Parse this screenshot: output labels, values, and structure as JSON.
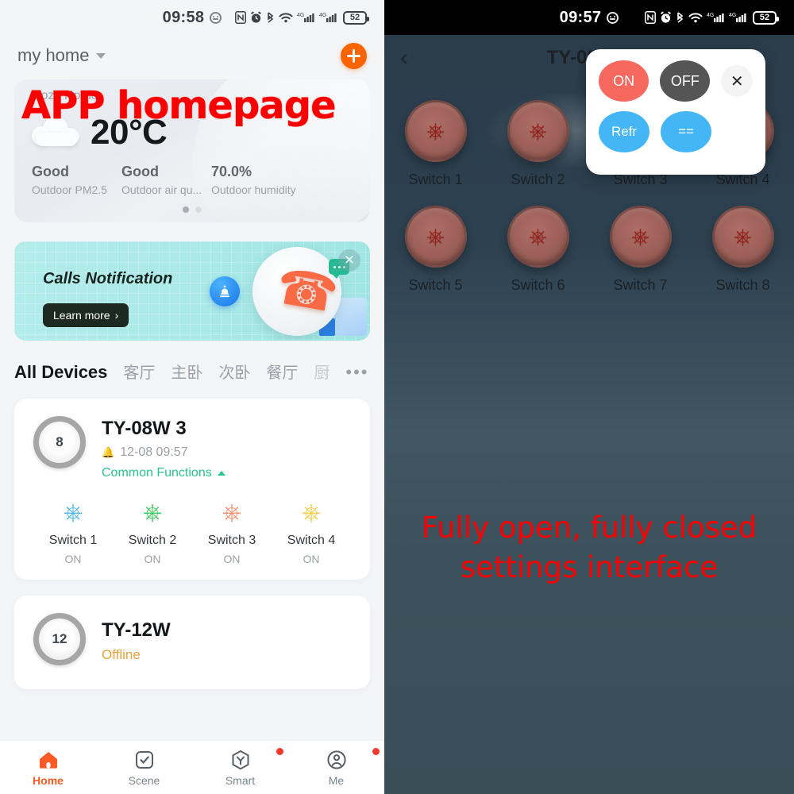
{
  "left": {
    "status_bar": {
      "time": "09:58",
      "icons": [
        "face-icon",
        "nfc-icon",
        "alarm-icon",
        "bluetooth-icon",
        "wifi-icon",
        "signal-4g-icon",
        "signal-4g-icon-2"
      ],
      "battery": "52"
    },
    "header": {
      "home_name": "my home",
      "chevron": "chevron-down-icon",
      "add": "add-icon"
    },
    "weather": {
      "subtitle": "Cozy Home",
      "temperature": "20°C",
      "icon": "cloud-icon",
      "stats": [
        {
          "value": "Good",
          "label": "Outdoor PM2.5"
        },
        {
          "value": "Good",
          "label": "Outdoor air qu..."
        },
        {
          "value": "70.0%",
          "label": "Outdoor humidity"
        }
      ],
      "pages": 2,
      "active_page": 1
    },
    "promo": {
      "title": "Calls Notification",
      "cta": "Learn more",
      "cta_chevron": "›",
      "close": "close-icon",
      "bell": "alarm-bell-icon",
      "phone": "phone-handset-icon",
      "chat": "chat-bubble-icon"
    },
    "rooms": [
      {
        "label": "All Devices",
        "active": true
      },
      {
        "label": "客厅",
        "active": false
      },
      {
        "label": "主卧",
        "active": false
      },
      {
        "label": "次卧",
        "active": false
      },
      {
        "label": "餐厅",
        "active": false
      },
      {
        "label": "厨",
        "active": false,
        "faded": true
      }
    ],
    "rooms_more": "•••",
    "devices": [
      {
        "badge": "8",
        "title": "TY-08W 3",
        "timestamp": "12-08 09:57",
        "bell": "bell-icon",
        "common_functions": "Common Functions",
        "switches": [
          {
            "name": "Switch 1",
            "state": "ON",
            "color": "#4fb8e8"
          },
          {
            "name": "Switch 2",
            "state": "ON",
            "color": "#3dcb5c"
          },
          {
            "name": "Switch 3",
            "state": "ON",
            "color": "#f29070"
          },
          {
            "name": "Switch 4",
            "state": "ON",
            "color": "#f0cf4a"
          }
        ]
      },
      {
        "badge": "12",
        "title": "TY-12W",
        "status": "Offline",
        "status_color": "#e8a33d"
      }
    ],
    "bottom_nav": [
      {
        "label": "Home",
        "icon": "home-icon",
        "active": true,
        "badge": false
      },
      {
        "label": "Scene",
        "icon": "scene-check-icon",
        "active": false,
        "badge": false
      },
      {
        "label": "Smart",
        "icon": "smart-hex-icon",
        "active": false,
        "badge": true
      },
      {
        "label": "Me",
        "icon": "account-icon",
        "active": false,
        "badge": true
      }
    ],
    "overlay_text": "APP homepage"
  },
  "right": {
    "status_bar": {
      "time": "09:57",
      "battery": "52"
    },
    "nav": {
      "back": "back-chevron-icon",
      "title": "TY-08W 3"
    },
    "switches": [
      {
        "name": "Switch 1"
      },
      {
        "name": "Switch 2"
      },
      {
        "name": "Switch 3"
      },
      {
        "name": "Switch 4"
      },
      {
        "name": "Switch 5"
      },
      {
        "name": "Switch 6"
      },
      {
        "name": "Switch 7"
      },
      {
        "name": "Switch 8"
      }
    ],
    "popup": {
      "on": "ON",
      "off": "OFF",
      "refresh": "Refr",
      "equals": "==",
      "close": "close-icon"
    },
    "overlay_text_line1": "Fully open, fully closed",
    "overlay_text_line2": "settings interface"
  },
  "colors": {
    "accent_orange": "#fa6400",
    "overlay_red": "#fa0000",
    "popup_on": "#f7685f",
    "popup_off": "#555555",
    "popup_blue": "#45b6f5",
    "green_link": "#2bc48a",
    "offline_amber": "#e8a33d"
  }
}
